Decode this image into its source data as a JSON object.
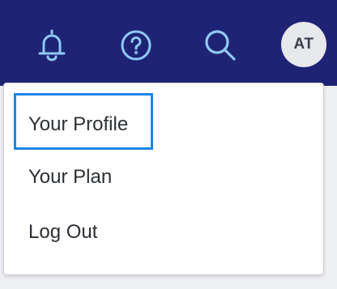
{
  "header": {
    "icons": {
      "notifications": "bell-icon",
      "help": "help-circle-icon",
      "search": "search-icon"
    },
    "avatar_initials": "AT",
    "colors": {
      "background": "#1f2375",
      "icon": "#8fc9f4",
      "avatar_bg": "#e7e8ec"
    }
  },
  "menu": {
    "items": [
      {
        "label": "Your Profile",
        "focused": true
      },
      {
        "label": "Your Plan"
      },
      {
        "label": "Log Out"
      }
    ],
    "focus_color": "#1a86e6"
  }
}
